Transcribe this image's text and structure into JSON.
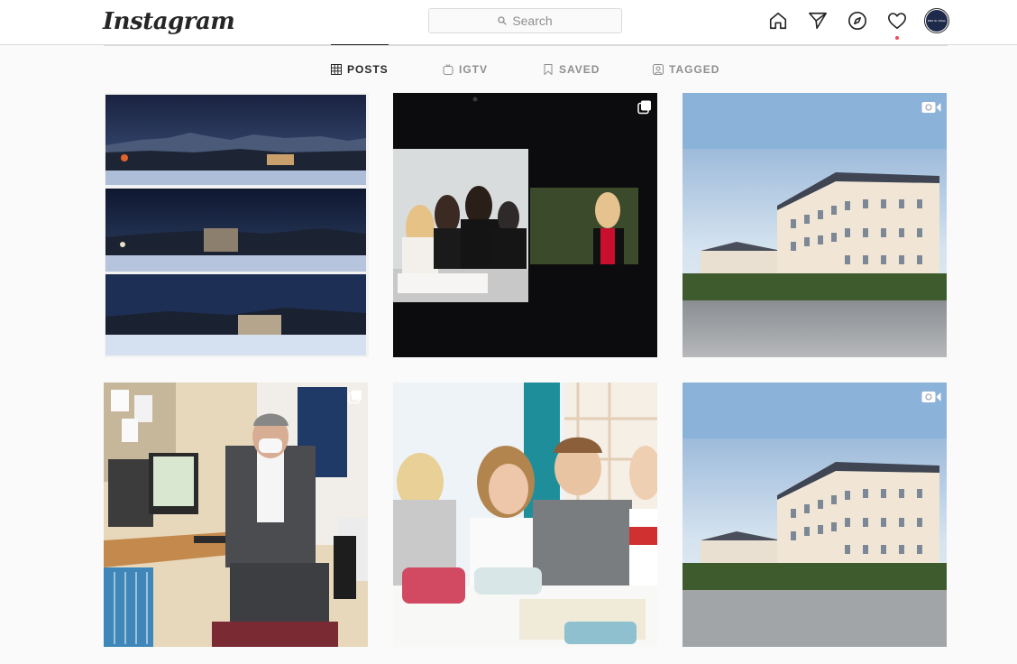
{
  "header": {
    "logo_text": "Instagram",
    "search_placeholder": "Search",
    "avatar_text": "BRG St. Pölten"
  },
  "tabs": [
    {
      "label": "POSTS",
      "icon": "grid-icon",
      "active": true
    },
    {
      "label": "IGTV",
      "icon": "igtv-icon",
      "active": false
    },
    {
      "label": "SAVED",
      "icon": "bookmark-icon",
      "active": false
    },
    {
      "label": "TAGGED",
      "icon": "tag-user-icon",
      "active": false
    }
  ],
  "posts": [
    {
      "type": "photo-collage",
      "badge": "none"
    },
    {
      "type": "photo",
      "badge": "carousel-icon"
    },
    {
      "type": "video",
      "badge": "video-icon"
    },
    {
      "type": "photo",
      "badge": "carousel-icon"
    },
    {
      "type": "photo",
      "badge": "none"
    },
    {
      "type": "video",
      "badge": "video-icon"
    }
  ],
  "colors": {
    "accent_dot": "#ed4956",
    "border": "#dbdbdb",
    "text": "#262626",
    "muted": "#8e8e8e"
  }
}
